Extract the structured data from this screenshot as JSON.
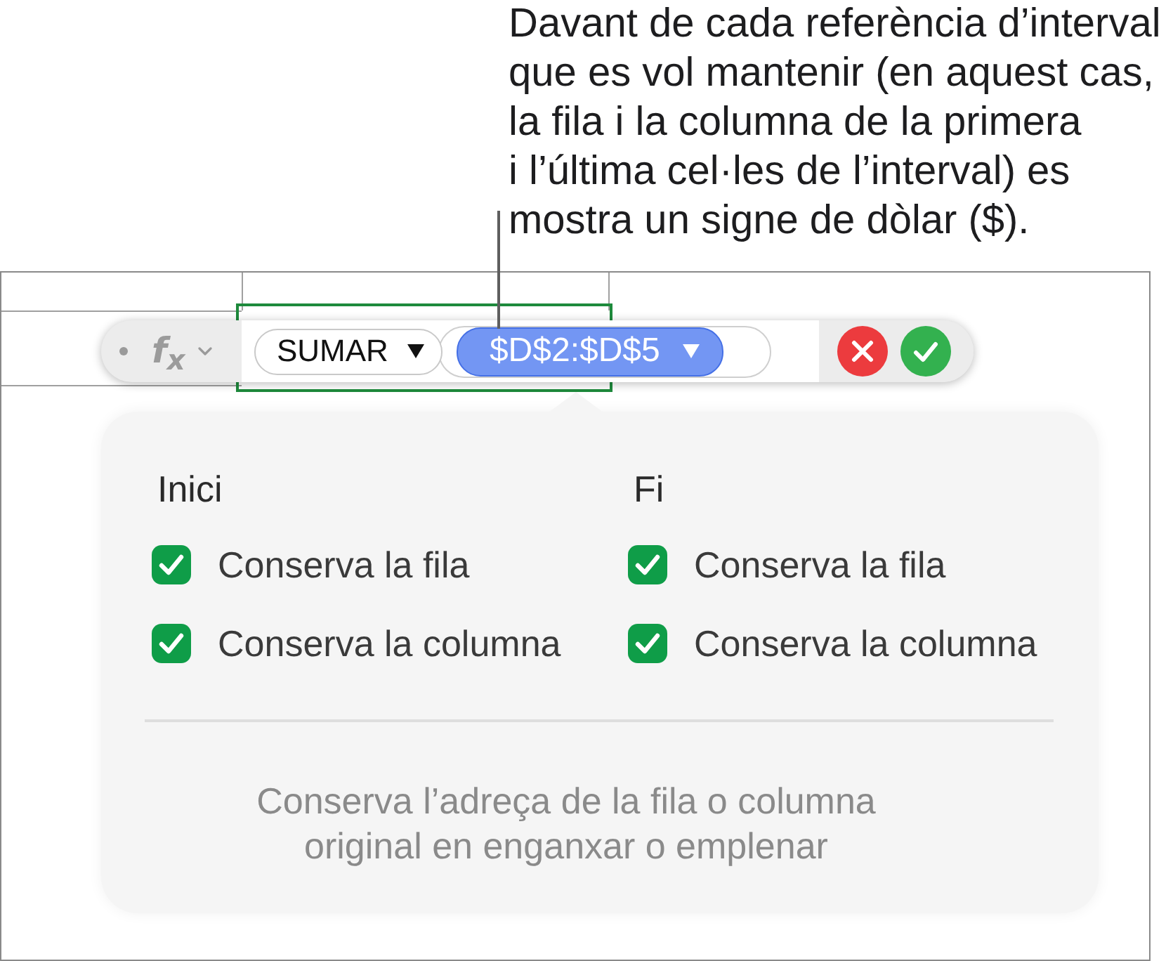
{
  "callout": {
    "lines": [
      "Davant de cada referència d’interval",
      "que es vol mantenir (en aquest cas,",
      "la fila i la columna de la primera",
      "i l’última cel·les de l’interval) es",
      "mostra un signe de dòlar ($)."
    ]
  },
  "formula_bar": {
    "function_label": "f$_{x}$",
    "tokens": [
      {
        "kind": "function",
        "text": "SUMAR",
        "selected": false
      },
      {
        "kind": "range",
        "text": "$D$2:$D$5",
        "selected": true
      }
    ]
  },
  "popover": {
    "columns": [
      {
        "heading": "Inici",
        "options": [
          {
            "label": "Conserva la fila",
            "checked": true
          },
          {
            "label": "Conserva la columna",
            "checked": true
          }
        ]
      },
      {
        "heading": "Fi",
        "options": [
          {
            "label": "Conserva la fila",
            "checked": true
          },
          {
            "label": "Conserva la columna",
            "checked": true
          }
        ]
      }
    ],
    "description": [
      "Conserva l’adreça de la fila o columna",
      "original en enganxar o emplenar"
    ]
  }
}
